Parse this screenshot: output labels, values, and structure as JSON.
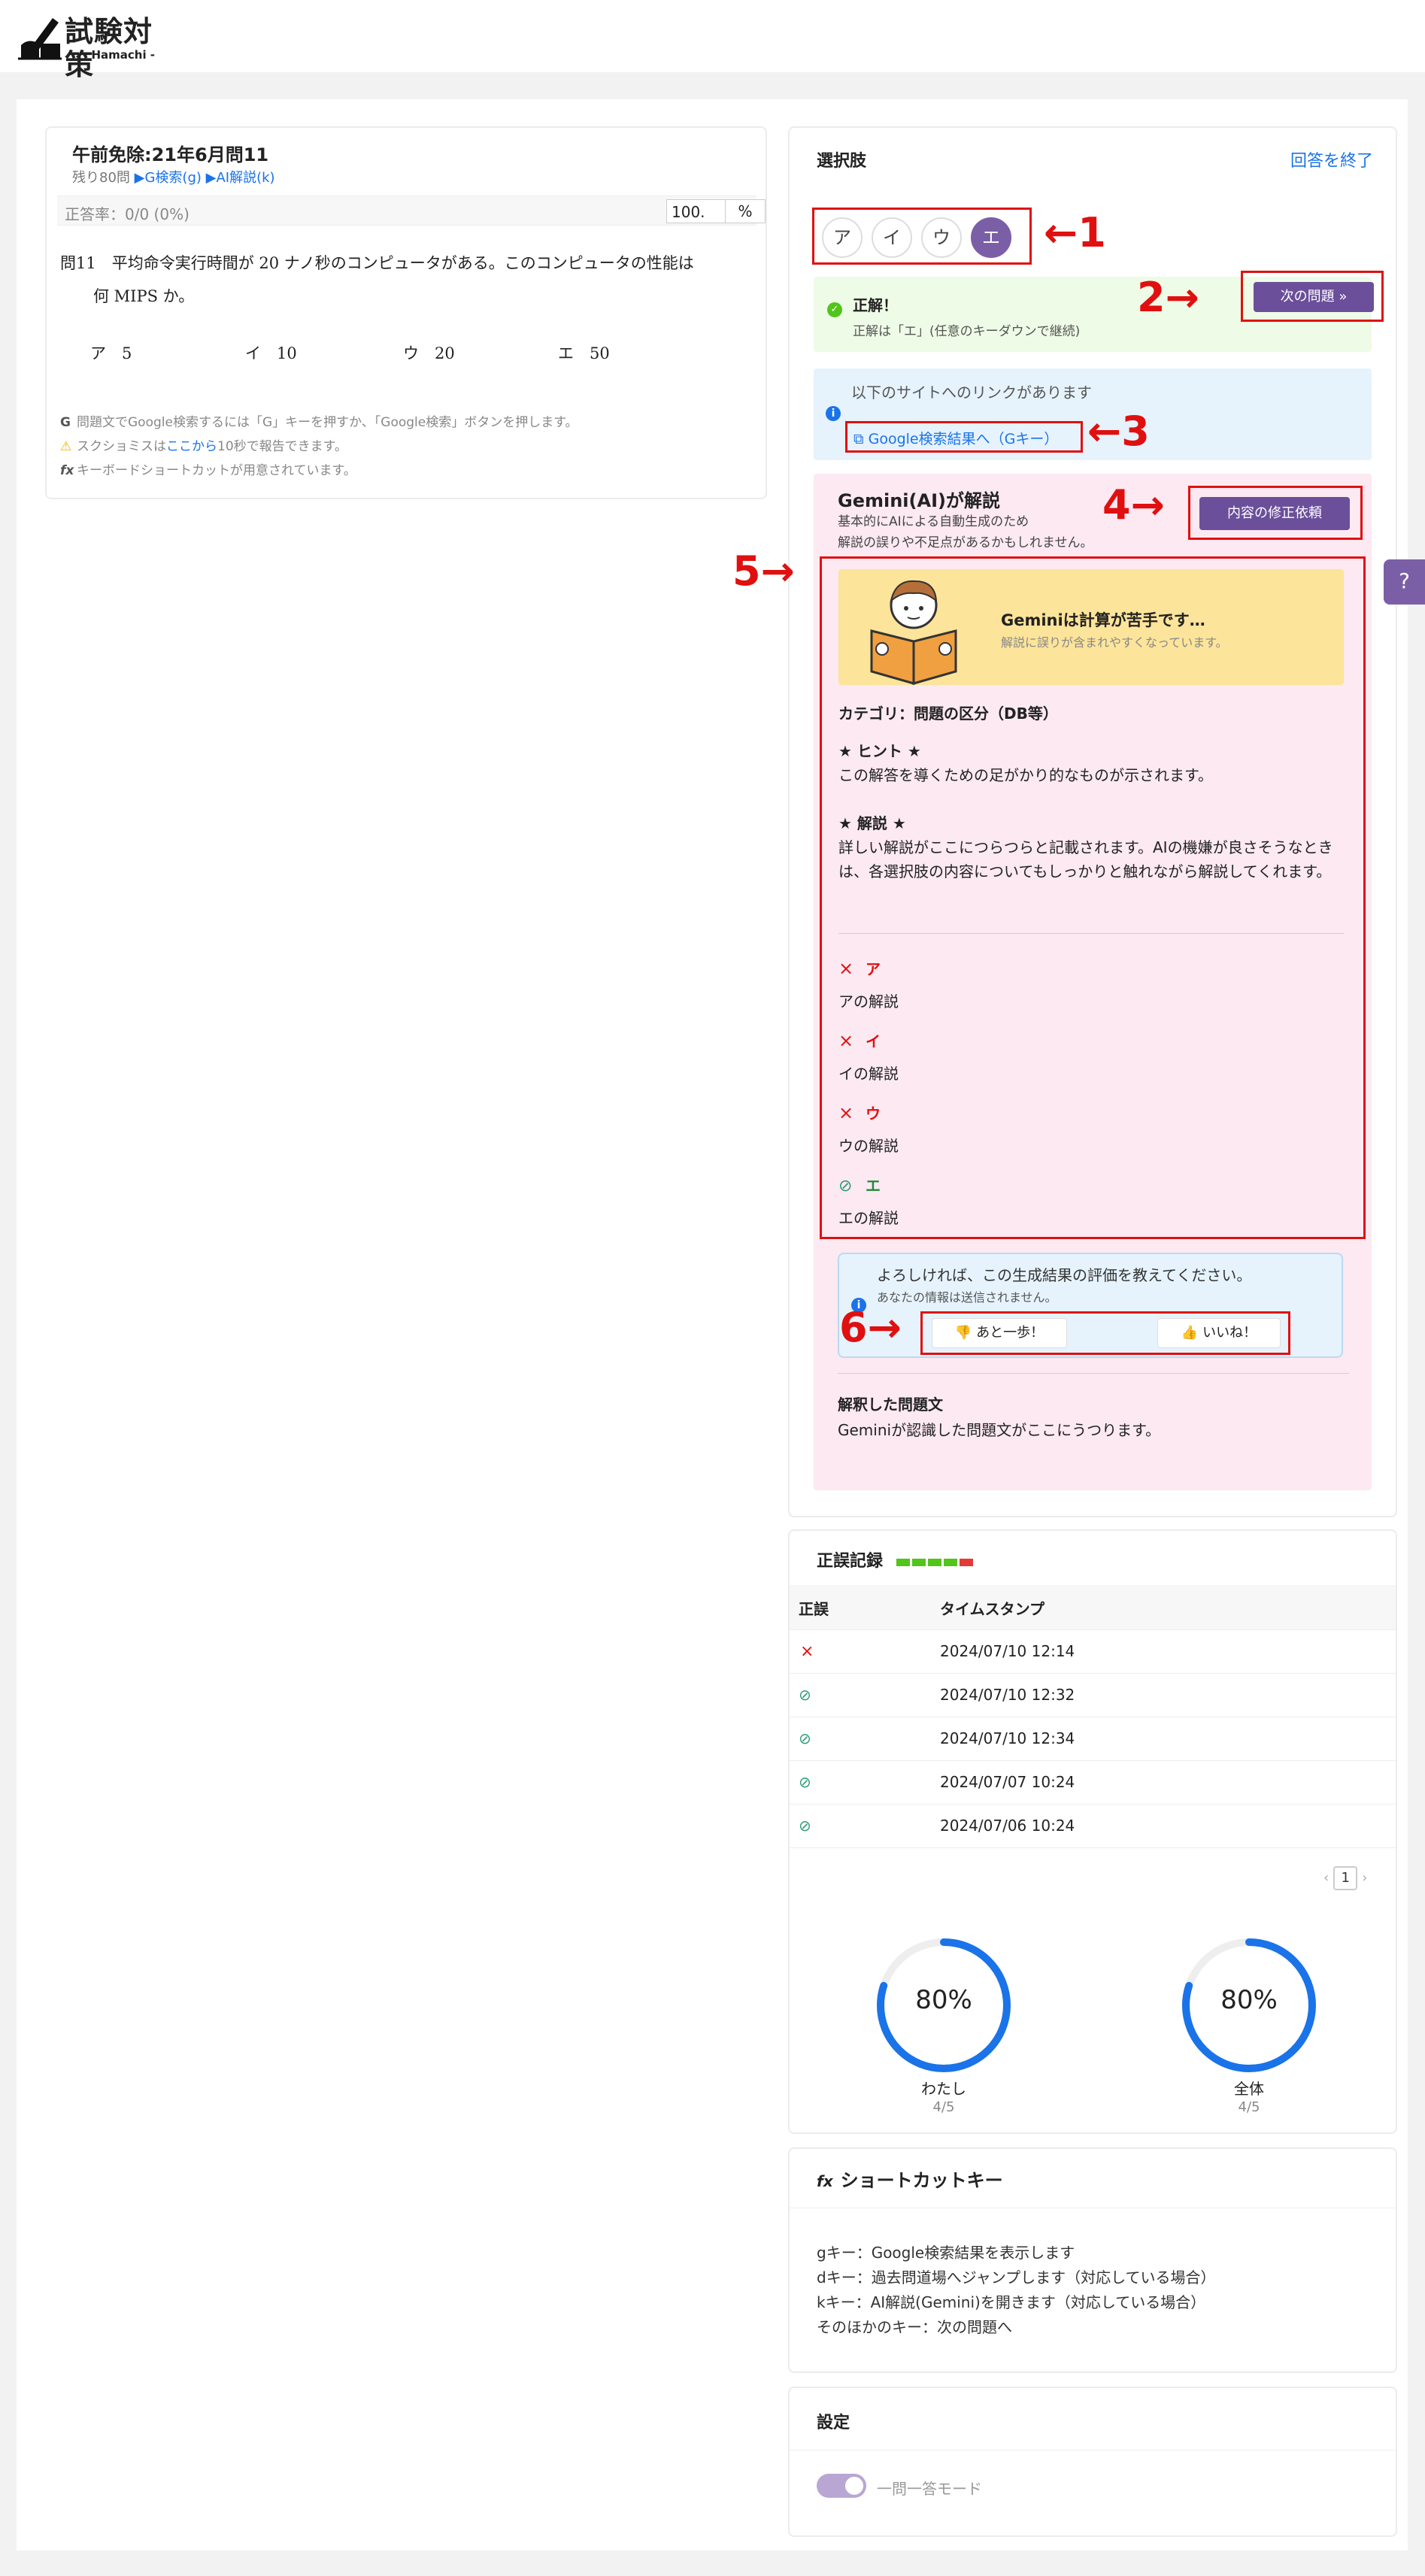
{
  "header": {
    "logo_title": "試験対策",
    "logo_sub": "- Hamachi -"
  },
  "question": {
    "title": "午前免除:21年6月問11",
    "remaining": "残り80問",
    "search_link": "▶G検索(g)",
    "ai_link": "▶AI解説(k)",
    "rate": "正答率：0/0 (0%)",
    "rate_value": "100.",
    "rate_unit": "%",
    "text_line1": "問11　平均命令実行時間が 20 ナノ秒のコンピュータがある。このコンピュータの性能は",
    "text_line2": "何 MIPS か。",
    "choices": [
      {
        "label": "ア　5"
      },
      {
        "label": "イ　10"
      },
      {
        "label": "ウ　20"
      },
      {
        "label": "エ　50"
      }
    ],
    "notes": [
      {
        "icon": "G",
        "text": "問題文でGoogle検索するには「G」キーを押すか、「Google検索」ボタンを押します。"
      },
      {
        "icon": "⚠",
        "pre": "スクショミスは",
        "link": "ここから",
        "post": "10秒で報告できます。"
      },
      {
        "icon": "fx",
        "text": "キーボードショートカットが用意されています。"
      }
    ]
  },
  "answer": {
    "title": "選択肢",
    "end_link": "回答を終了",
    "buttons": [
      "ア",
      "イ",
      "ウ",
      "エ"
    ],
    "selected": "エ",
    "markers": [
      "←1",
      "2→",
      "←3",
      "4→",
      "5→",
      "6→"
    ],
    "result_title": "正解！",
    "result_sub": "正解は「エ」(任意のキーダウンで継続)",
    "next_button": "次の問題",
    "link_note": "以下のサイトへのリンクがあります",
    "google_link": "Google検索結果へ（Gキー）",
    "gemini_title": "Gemini(AI)が解説",
    "gemini_sub1": "基本的にAIによる自動生成のため",
    "gemini_sub2": "解説の誤りや不足点があるかもしれません。",
    "fix_button": "内容の修正依頼",
    "banner_title": "Geminiは計算が苦手です…",
    "banner_sub": "解説に誤りが含まれやすくなっています。",
    "category": "カテゴリ：問題の区分（DB等）",
    "hint_title": "★ ヒント ★",
    "hint_text": "この解答を導くための足がかり的なものが示されます。",
    "expl_title": "★ 解説 ★",
    "expl_text": "詳しい解説がここにつらつらと記載されます。AIの機嫌が良さそうなときは、各選択肢の内容についてもしっかりと触れながら解説してくれます。",
    "choice_expl": [
      {
        "key": "ア",
        "text": "アの解説",
        "correct": false
      },
      {
        "key": "イ",
        "text": "イの解説",
        "correct": false
      },
      {
        "key": "ウ",
        "text": "ウの解説",
        "correct": false
      },
      {
        "key": "エ",
        "text": "エの解説",
        "correct": true
      }
    ],
    "feedback_title": "よろしければ、この生成結果の評価を教えてください。",
    "feedback_sub": "あなたの情報は送信されません。",
    "feedback_bad": "あと一歩！",
    "feedback_good": "いいね！",
    "interp_title": "解釈した問題文",
    "interp_text": "Geminiが認識した問題文がここにうつります。"
  },
  "history": {
    "title": "正誤記録",
    "bar_colors": [
      "#52c41a",
      "#52c41a",
      "#52c41a",
      "#52c41a",
      "#e53935"
    ],
    "col_result": "正誤",
    "col_time": "タイムスタンプ",
    "rows": [
      {
        "correct": false,
        "time": "2024/07/10 12:14"
      },
      {
        "correct": true,
        "time": "2024/07/10 12:32"
      },
      {
        "correct": true,
        "time": "2024/07/10 12:34"
      },
      {
        "correct": true,
        "time": "2024/07/07 10:24"
      },
      {
        "correct": true,
        "time": "2024/07/06 10:24"
      }
    ],
    "page": "1",
    "stats": [
      {
        "label": "わたし",
        "percent": 80,
        "percent_text": "80%",
        "fraction": "4/5"
      },
      {
        "label": "全体",
        "percent": 80,
        "percent_text": "80%",
        "fraction": "4/5"
      }
    ]
  },
  "shortcuts": {
    "title": "ショートカットキー",
    "icon": "fx",
    "lines": [
      "gキー：Google検索結果を表示します",
      "dキー：過去問道場へジャンプします（対応している場合）",
      "kキー：AI解説(Gemini)を開きます（対応している場合）",
      "そのほかのキー：次の問題へ"
    ]
  },
  "settings": {
    "title": "設定",
    "toggle_label": "一問一答モード"
  },
  "help_button": "?"
}
